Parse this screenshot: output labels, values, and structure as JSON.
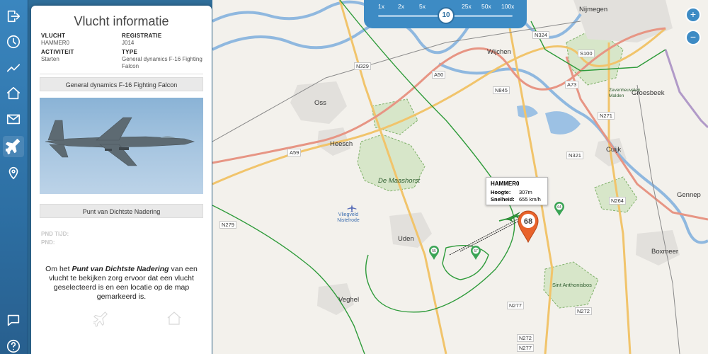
{
  "rail": {
    "items": [
      {
        "name": "logout-icon"
      },
      {
        "name": "clock-icon"
      },
      {
        "name": "chart-icon"
      },
      {
        "name": "home-icon"
      },
      {
        "name": "mail-icon"
      },
      {
        "name": "plane-icon"
      },
      {
        "name": "location-icon"
      },
      {
        "name": "chat-icon"
      },
      {
        "name": "help-icon"
      }
    ]
  },
  "panel": {
    "title": "Vlucht informatie",
    "vlucht_label": "VLUCHT",
    "vlucht_value": "HAMMER0",
    "registratie_label": "REGISTRATIE",
    "registratie_value": "J014",
    "activiteit_label": "ACTIVITEIT",
    "activiteit_value": "Starten",
    "type_label": "TYPE",
    "type_value": "General dynamics F-16 Fighting Falcon",
    "aircraft_bar": "General dynamics F-16 Fighting Falcon",
    "pdn_bar": "Punt van Dichtste Nadering",
    "pdn_tijd_label": "PND TIJD:",
    "pdn_label": "PND:",
    "pdn_msg_pre": "Om het ",
    "pdn_msg_em": "Punt van Dichtste Nadering",
    "pdn_msg_post": " van een vlucht te bekijken zorg ervoor dat een vlucht geselecteerd is en een locatie op de map gemarkeerd is."
  },
  "speed": {
    "options": [
      "1x",
      "2x",
      "5x",
      "25x",
      "50x",
      "100x"
    ],
    "current": "10"
  },
  "zoom": {
    "in": "+",
    "out": "−"
  },
  "tooltip": {
    "name": "HAMMER0",
    "hoogte_label": "Hoogte:",
    "hoogte_value": "307m",
    "snelheid_label": "Snelheid:",
    "snelheid_value": "655 km/h"
  },
  "marker_count": "68",
  "small_markers": [
    "55",
    "57",
    "64"
  ],
  "places": {
    "nijmegen": "Nijmegen",
    "wijchen": "Wijchen",
    "oss": "Oss",
    "groesbeek": "Groesbeek",
    "heesch": "Heesch",
    "cuijk": "Cuijk",
    "maashorst": "De Maashorst",
    "vliegveld": "Vliegveld Nistelrode",
    "uden": "Uden",
    "gennep": "Gennep",
    "boxmeer": "Boxmeer",
    "veghel": "Veghel",
    "anthonis": "Sint Anthonisbos",
    "zwitserland": "Zevenheuvelen Malden"
  },
  "roads": {
    "n324": "N324",
    "s100": "S100",
    "n329": "N329",
    "a50": "A50",
    "n845": "N845",
    "a73": "A73",
    "n271": "N271",
    "a59": "A59",
    "n321": "N321",
    "n264": "N264",
    "n279": "N279",
    "n277": "N277",
    "n272": "N272",
    "n272b": "N272",
    "n277b": "N277"
  },
  "colors": {
    "accent": "#3d8bc4",
    "marker": "#e8632b",
    "boundary": "#2e9b3a"
  }
}
